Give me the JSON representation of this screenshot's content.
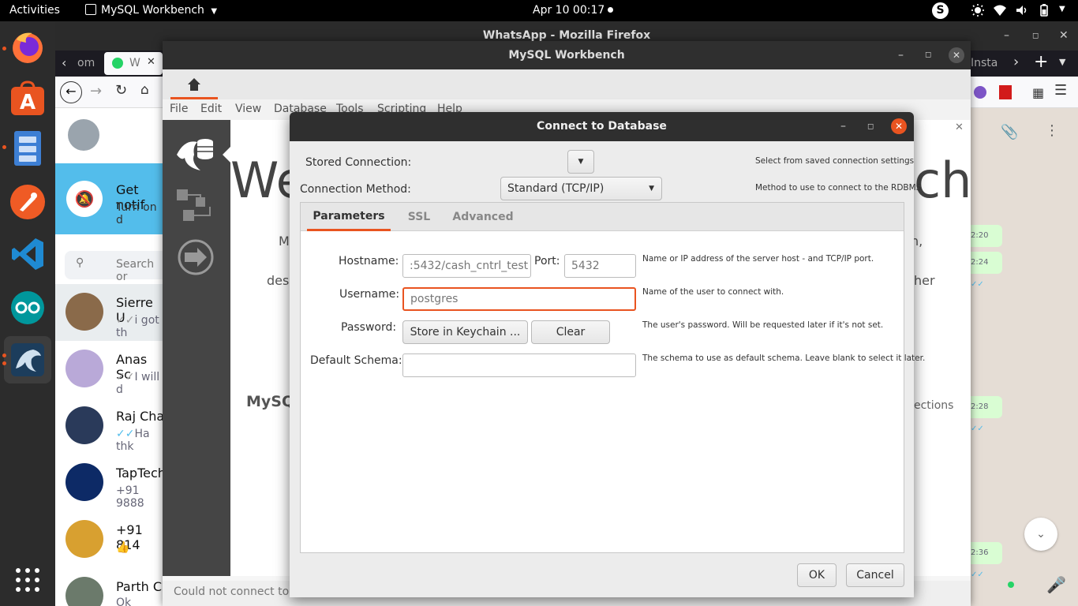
{
  "topbar": {
    "activities": "Activities",
    "app_menu": "MySQL Workbench",
    "clock": "Apr 10  00:17"
  },
  "firefox": {
    "title": "WhatsApp - Mozilla Firefox",
    "tab1": "om",
    "tab2": "W",
    "tab_right": "Insta",
    "notif_title": "Get notif",
    "notif_sub": "Turn on d",
    "search_placeholder": "Search or",
    "chats": [
      {
        "name": "Sierre U",
        "preview": "i got th"
      },
      {
        "name": "Anas Sc",
        "preview": "I will d"
      },
      {
        "name": "Raj Cha",
        "preview": "Ha thk"
      },
      {
        "name": "TapTech",
        "preview": "+91 9888"
      },
      {
        "name": "+91 814",
        "preview": "👍"
      },
      {
        "name": "Parth C",
        "preview": "Ok"
      }
    ],
    "times": [
      "2:20",
      "2:24",
      "2:28",
      "2:36"
    ]
  },
  "workbench": {
    "title": "MySQL Workbench",
    "menu": [
      "File",
      "Edit",
      "View",
      "Database",
      "Tools",
      "Scripting",
      "Help"
    ],
    "welcome_start": "We",
    "welcome_end": "ch",
    "frag_m": "M",
    "frag_comma": "n,",
    "frag_des": "des",
    "frag_her": "her",
    "frag_mysq": "MySQ",
    "frag_ections": "ections",
    "status": "Could not connect to t"
  },
  "dialog": {
    "title": "Connect to Database",
    "stored_connection_label": "Stored Connection:",
    "stored_connection_hint": "Select from saved connection settings",
    "method_label": "Connection Method:",
    "method_value": "Standard (TCP/IP)",
    "method_hint": "Method to use to connect to the RDBMS",
    "tabs": [
      "Parameters",
      "SSL",
      "Advanced"
    ],
    "hostname_label": "Hostname:",
    "hostname_value": ":5432/cash_cntrl_test",
    "port_label": "Port:",
    "port_value": "5432",
    "hostname_hint": "Name or IP address of the server host - and TCP/IP port.",
    "username_label": "Username:",
    "username_value": "postgres",
    "username_hint": "Name of the user to connect with.",
    "password_label": "Password:",
    "store_keychain": "Store in Keychain ...",
    "clear": "Clear",
    "password_hint": "The user's password. Will be requested later if it's not set.",
    "schema_label": "Default Schema:",
    "schema_value": "",
    "schema_hint": "The schema to use as default schema. Leave blank to select it later.",
    "ok": "OK",
    "cancel": "Cancel"
  }
}
